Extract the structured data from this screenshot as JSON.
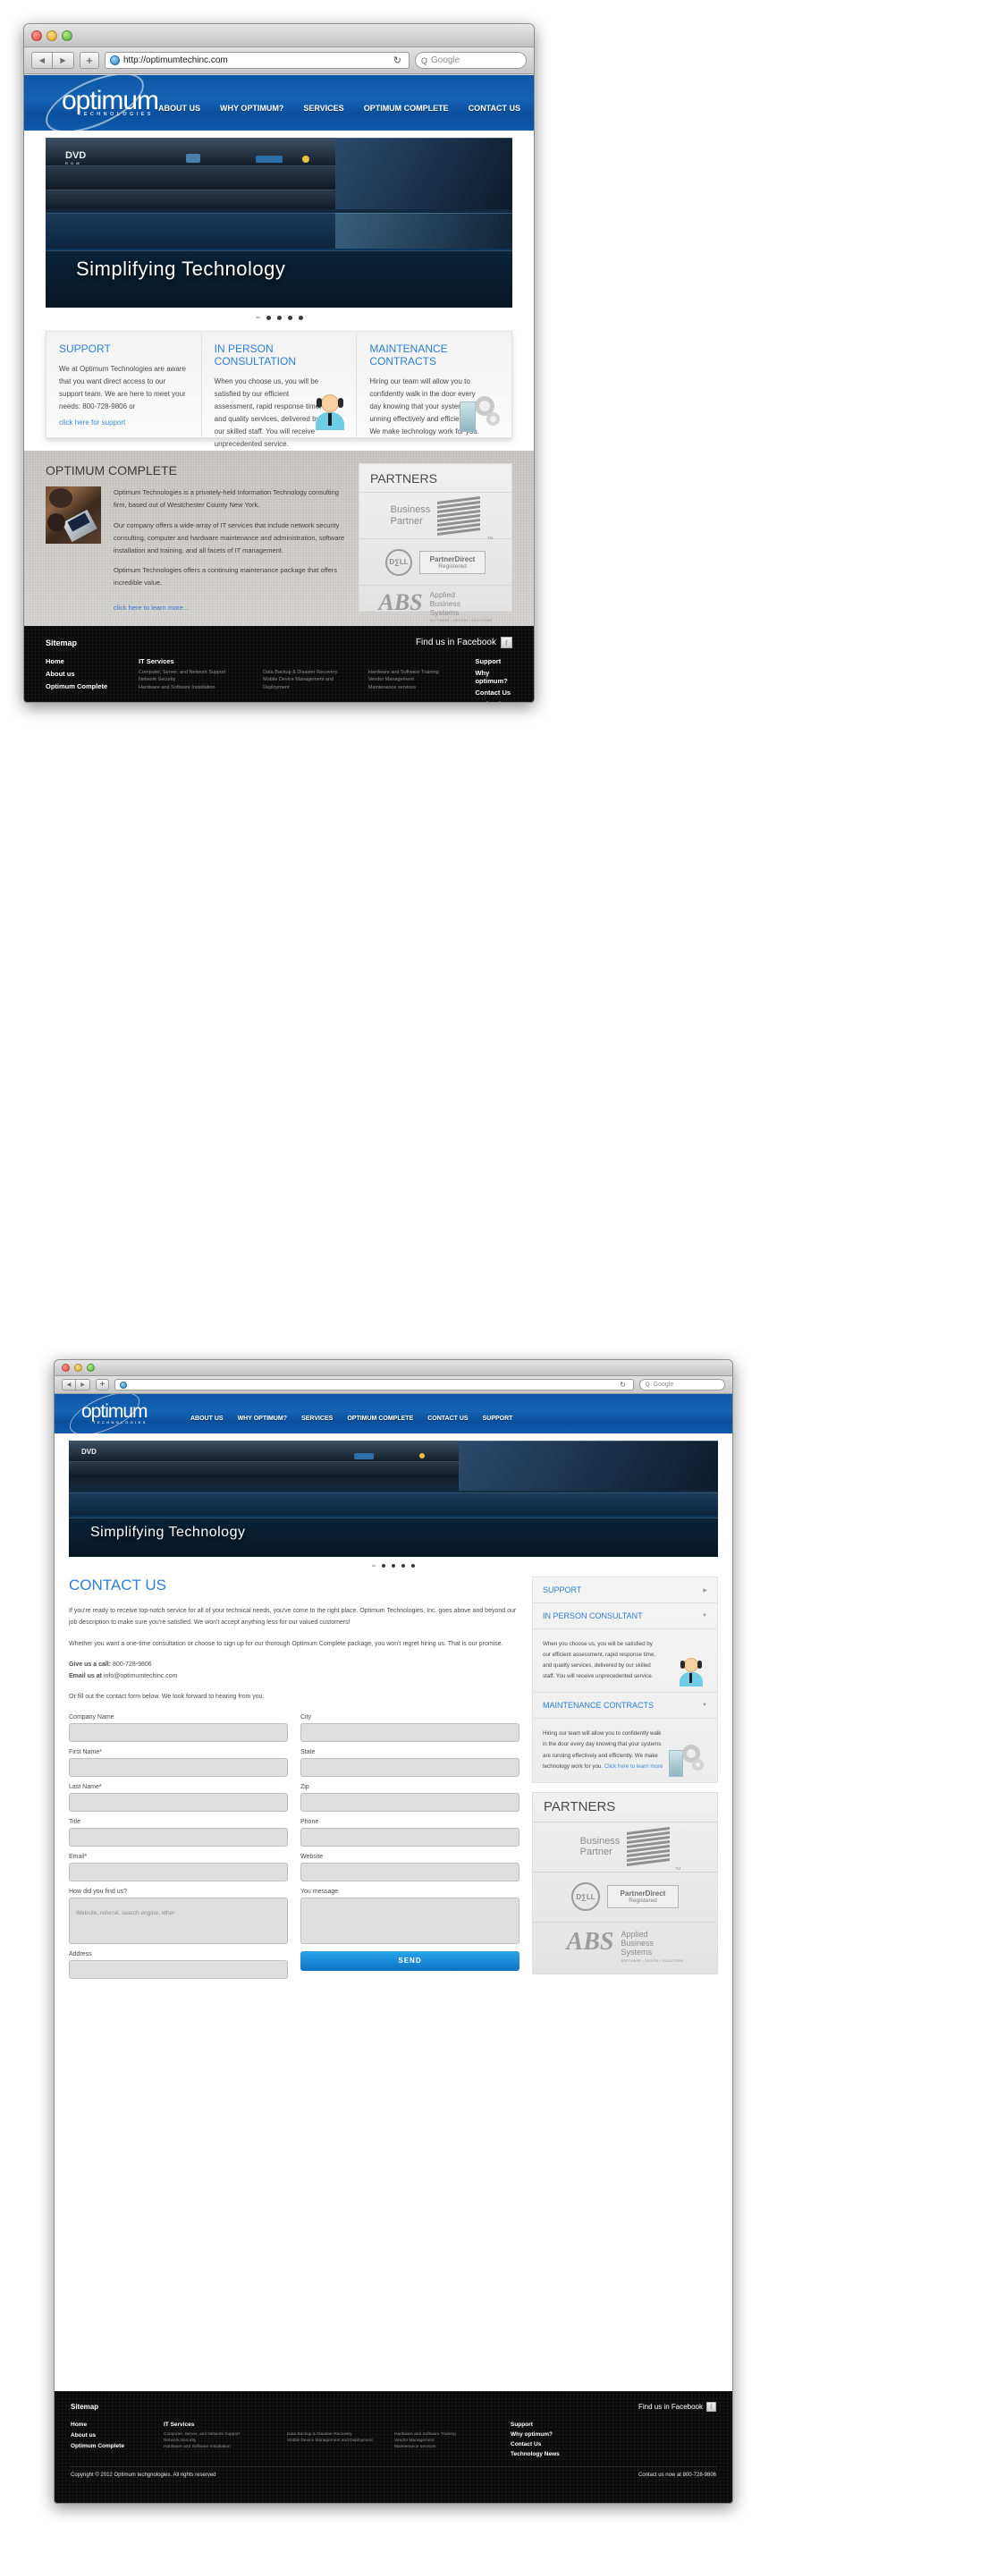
{
  "brand": {
    "accent": "#2d7fd4",
    "header_blue": "#0d58a6",
    "link": "#3b8ddd"
  },
  "browser": {
    "url": "http://optimumtechinc.com",
    "search_placeholder": "Google",
    "search_label": "Q",
    "back_glyph": "◀",
    "forward_glyph": "▶",
    "plus_glyph": "+",
    "reload_glyph": "↻"
  },
  "logo": {
    "name": "optimum",
    "tagline": "TECHNOLOGIES"
  },
  "nav": [
    {
      "label": "ABOUT US"
    },
    {
      "label": "WHY OPTIMUM?"
    },
    {
      "label": "SERVICES"
    },
    {
      "label": "OPTIMUM COMPLETE"
    },
    {
      "label": "CONTACT US"
    },
    {
      "label": "SUPPORT"
    }
  ],
  "hero": {
    "caption": "Simplifying Technology",
    "dvd_label": "DVD",
    "dvd_sub": "R O M",
    "slide_count": 4
  },
  "boxes": [
    {
      "title": "SUPPORT",
      "body": "We at Optimum Technologies are aware that you want direct access to our support team. We are here to meet your needs: 800-728-9806 or",
      "link": "click here for support"
    },
    {
      "title": "IN PERSON CONSULTATION",
      "body": "When you choose us, you will be satisfied by our efficient assessment, rapid response time, and quality services, delivered by our skilled staff. You will receive unprecedented service.",
      "link": ""
    },
    {
      "title": "MAINTENANCE CONTRACTS",
      "body": "Hiring our team will allow you to confidently walk in the door every day knowing that your systems are unning effectively and efficiently. We make technology work for you.",
      "link": ""
    }
  ],
  "complete": {
    "title": "OPTIMUM COMPLETE",
    "p1": "Optimum Technologies is a privately-held Information Technology consulting firm, based out of Westchester County New York.",
    "p2": "Our company offers a wide-array of IT services that include network security consulting, computer and hardware maintenance and administration, software installation and training, and all facets of IT management.",
    "p3": "Optimum Technologies offers a continuing maintenance package that offers incredible value.",
    "link": "click here to learn more..."
  },
  "partners": {
    "title": "PARTNERS",
    "items": [
      {
        "name": "IBM Business Partner",
        "line1": "Business",
        "line2": "Partner",
        "mark": "IBM",
        "tm": "TM"
      },
      {
        "name": "Dell PartnerDirect",
        "brand": "D∑LL",
        "line1": "PartnerDirect",
        "line2": "Registered"
      },
      {
        "name": "Applied Business Systems",
        "mark": "ABS",
        "line1": "Applied",
        "line2": "Business",
        "line3": "Systems",
        "sub": "SOFTWARE • DESIGN • SOLUTIONS"
      }
    ]
  },
  "footer": {
    "sitemap_title": "Sitemap",
    "facebook_text": "Find us in Facebook",
    "facebook_glyph": "f",
    "col1": [
      "Home",
      "About us",
      "Optimum Complete"
    ],
    "services_title": "IT Services",
    "services_col1": [
      "Computer, Server, and Network Support",
      "Network Security",
      "Hardware and Software Installation"
    ],
    "services_col2": [
      "Data Backup & Disaster Recovery",
      "Mobile Device Management and Deployment"
    ],
    "services_col3": [
      "Hardware and Software Training",
      "Vendor Management",
      "Maintenance services"
    ],
    "col_right": [
      "Support",
      "Why optimum?",
      "Contact Us",
      "Technology News"
    ],
    "copyright": "Copyright © 2012 Optimum techgnologies. All rights reserved",
    "contact": "Contact us now at 800-728-9806"
  },
  "contact_page": {
    "title": "CONTACT US",
    "p1": "If you're ready to receive top-notch service for all of your technical needs, you've come to the right place. Optimum Technologies, Inc. goes above and beyond our job description to make sure you're satisfied. We won't accept anything less for our valued customers!",
    "p2": "Whether you want a one-time consultation or choose to sign up for our thorough Optimum Complete package, you won't regret hiring us. That is our promise.",
    "call_label": "Give us a call:",
    "call_value": "800-728-9806",
    "email_label": "Email us at",
    "email_value": "info@optimumtechinc.com",
    "p3": "Or fill out the contact form below. We look forward to hearing from you.",
    "fields_left": [
      {
        "label": "Company Name",
        "value": "",
        "placeholder": ""
      },
      {
        "label": "First Name*",
        "value": "",
        "placeholder": ""
      },
      {
        "label": "Last Name*",
        "value": "",
        "placeholder": ""
      },
      {
        "label": "Title",
        "value": "",
        "placeholder": ""
      },
      {
        "label": "Email*",
        "value": "",
        "placeholder": ""
      },
      {
        "label": "How did you find us?",
        "value": "",
        "placeholder": "Website, referral, search engine, other"
      },
      {
        "label": "Address",
        "value": "",
        "placeholder": ""
      }
    ],
    "fields_right": [
      {
        "label": "City",
        "value": "",
        "placeholder": ""
      },
      {
        "label": "State",
        "value": "",
        "placeholder": ""
      },
      {
        "label": "Zip",
        "value": "",
        "placeholder": ""
      },
      {
        "label": "Phone",
        "value": "",
        "placeholder": ""
      },
      {
        "label": "Website",
        "value": "",
        "placeholder": ""
      },
      {
        "label": "You message",
        "value": "",
        "placeholder": ""
      }
    ],
    "send_label": "SEND"
  },
  "accordion": [
    {
      "title": "SUPPORT",
      "caret": "▶",
      "open": false,
      "body": "",
      "link": ""
    },
    {
      "title": "IN PERSON CONSULTANT",
      "caret": "▼",
      "open": true,
      "body": "When you choose us, you will be satisfied by our efficient assessment, rapid response time, and quality services, delivered by our skilled staff. You will receive unprecedented service.",
      "link": ""
    },
    {
      "title": "MAINTENANCE CONTRACTS",
      "caret": "▼",
      "open": true,
      "body": "Hiring our team will allow you to confidently walk in the door every day knowing that your systems are running effectively and efficiently. We make technology work for you.",
      "link": "Click here to learn more"
    }
  ],
  "accordion_back": [
    {
      "title": "IN PERSON CONSULTANT",
      "caret": "▶"
    },
    {
      "title": "MAINTENANCE CONTRACTS",
      "caret": "▶"
    }
  ],
  "dropdown": {
    "items": [
      "Hardware and Software Training",
      "Vendor Management"
    ]
  }
}
